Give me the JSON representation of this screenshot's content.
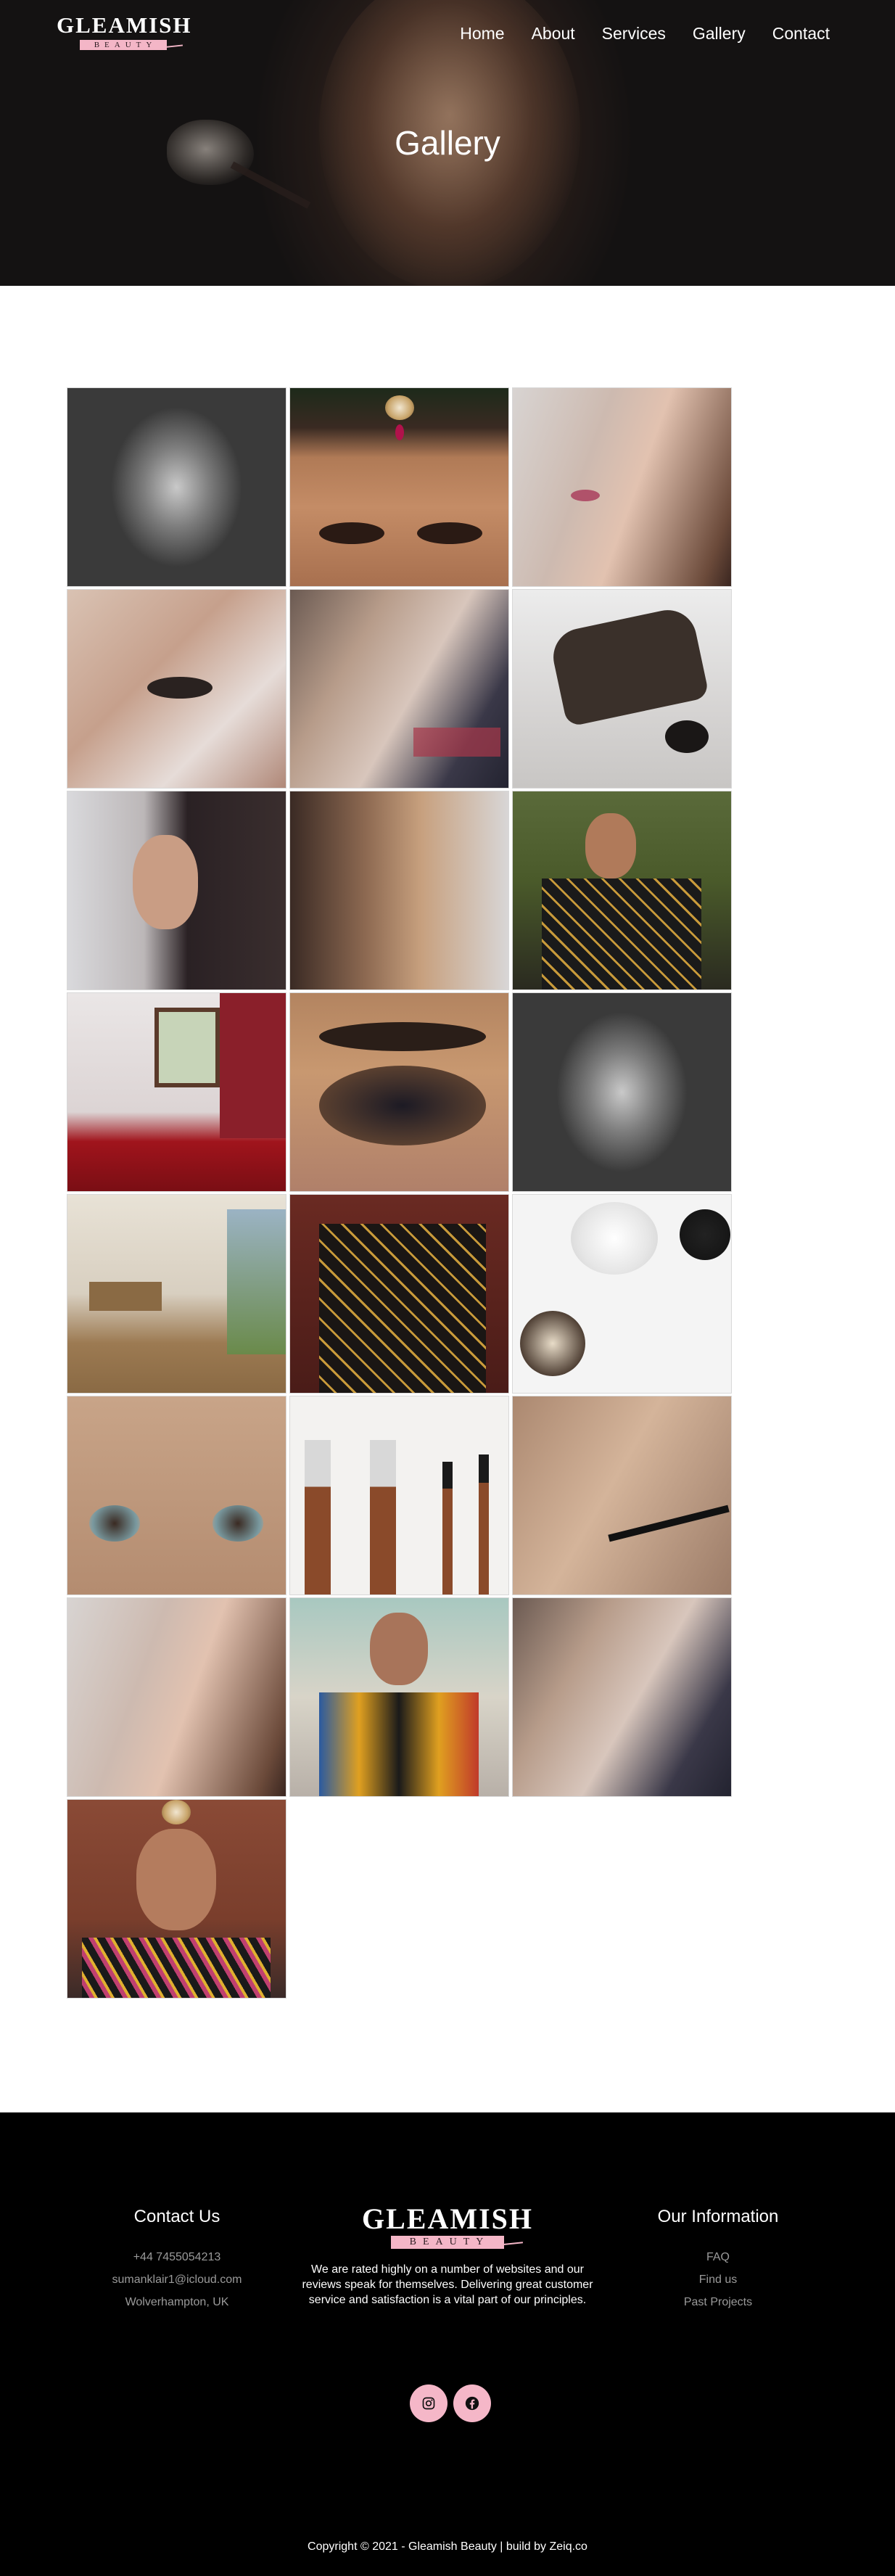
{
  "brand": {
    "name": "GLEAMISH",
    "tagline": "BEAUTY",
    "pink": "#f4b6c7"
  },
  "nav": [
    {
      "label": "Home"
    },
    {
      "label": "About"
    },
    {
      "label": "Services"
    },
    {
      "label": "Gallery"
    },
    {
      "label": "Contact"
    }
  ],
  "hero": {
    "title": "Gallery"
  },
  "gallery": {
    "images": [
      "woman-hair-bw",
      "bride-forehead-tikka",
      "lipstick-application",
      "eyelash-application",
      "makeup-artist-station",
      "makeup-bag",
      "woman-dark-hair-portrait",
      "woman-hair-profile",
      "woman-garden-embroidered",
      "salon-room-red-carpet",
      "smokey-eye-closeup",
      "woman-hair-bw",
      "salon-interior-dining",
      "embroidered-jacket",
      "brushes-powder-flatlay",
      "eyes-closeup",
      "brush-set",
      "mascara-application",
      "lipstick-application",
      "woman-embroidered-top",
      "makeup-artist-station",
      "bride-tikka-brick"
    ]
  },
  "footer": {
    "contact": {
      "title": "Contact Us",
      "phone": "+44 7455054213",
      "email": "sumanklair1@icloud.com",
      "location": "Wolverhampton, UK"
    },
    "about": "We are rated highly on a number of websites and our reviews speak for themselves. Delivering great customer service and satisfaction is a vital part of our principles.",
    "info": {
      "title": "Our Information",
      "links": [
        {
          "label": "FAQ"
        },
        {
          "label": "Find us"
        },
        {
          "label": "Past Projects"
        }
      ]
    },
    "social": [
      {
        "icon": "instagram-icon"
      },
      {
        "icon": "facebook-icon"
      }
    ],
    "copyright": "Copyright © 2021 - Gleamish Beauty | build by Zeiq.co"
  }
}
